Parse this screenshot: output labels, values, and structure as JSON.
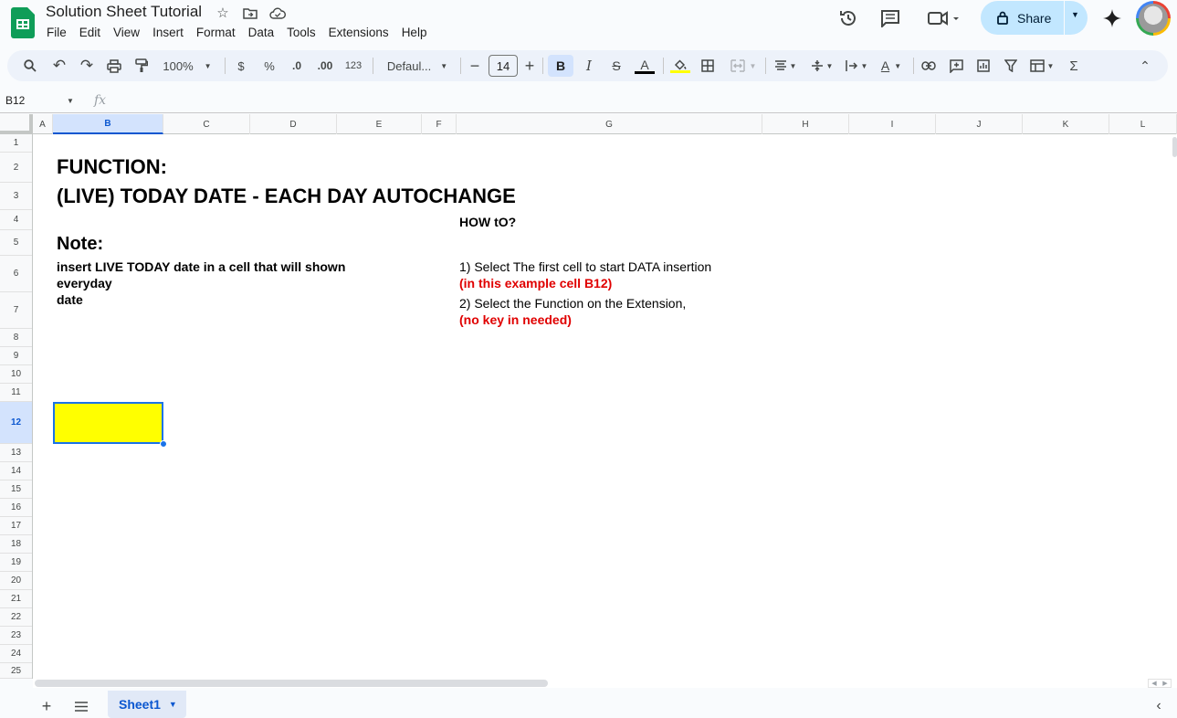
{
  "doc": {
    "title": "Solution Sheet Tutorial"
  },
  "menu": [
    "File",
    "Edit",
    "View",
    "Insert",
    "Format",
    "Data",
    "Tools",
    "Extensions",
    "Help"
  ],
  "header_right": {
    "share_label": "Share"
  },
  "toolbar": {
    "zoom": "100%",
    "currency": "$",
    "percent": "%",
    "dec_decrease": ".0",
    "dec_increase": ".00",
    "number_format": "123",
    "font": "Defaul...",
    "font_size": "14",
    "bold": "B",
    "italic": "I",
    "text_color": "A",
    "sum": "Σ"
  },
  "formula_bar": {
    "name_box": "B12",
    "fx": "fx"
  },
  "columns": [
    "A",
    "B",
    "C",
    "D",
    "E",
    "F",
    "G",
    "H",
    "I",
    "J",
    "K",
    "L"
  ],
  "selected_column": "B",
  "rows": [
    "1",
    "2",
    "3",
    "4",
    "5",
    "6",
    "7",
    "8",
    "9",
    "10",
    "11",
    "12",
    "13",
    "14",
    "15",
    "16",
    "17",
    "18",
    "19",
    "20",
    "21",
    "22",
    "23",
    "24",
    "25"
  ],
  "selected_row": "12",
  "cells": {
    "b2": "FUNCTION:",
    "b3": "(LIVE) TODAY DATE - EACH DAY AUTOCHANGE",
    "g4": "HOW tO?",
    "b5": "Note:",
    "b6_line1": "insert LIVE TODAY date in a cell that will shown",
    "b6_line2": "everyday",
    "b6_line3": "date",
    "g6_line1": "1) Select The first cell to start DATA insertion",
    "g6_line2": "(in this example cell B12)",
    "g7_line1": "2) Select the Function on the Extension,",
    "g7_line2": "(no key in needed)",
    "b12_fill": "#ffff00"
  },
  "sheets": [
    {
      "name": "Sheet1",
      "active": true
    }
  ],
  "colors": {
    "accent": "#0b57d0",
    "share_bg": "#c2e7ff",
    "red_text": "#e00000",
    "sheets_green": "#0f9d58"
  }
}
